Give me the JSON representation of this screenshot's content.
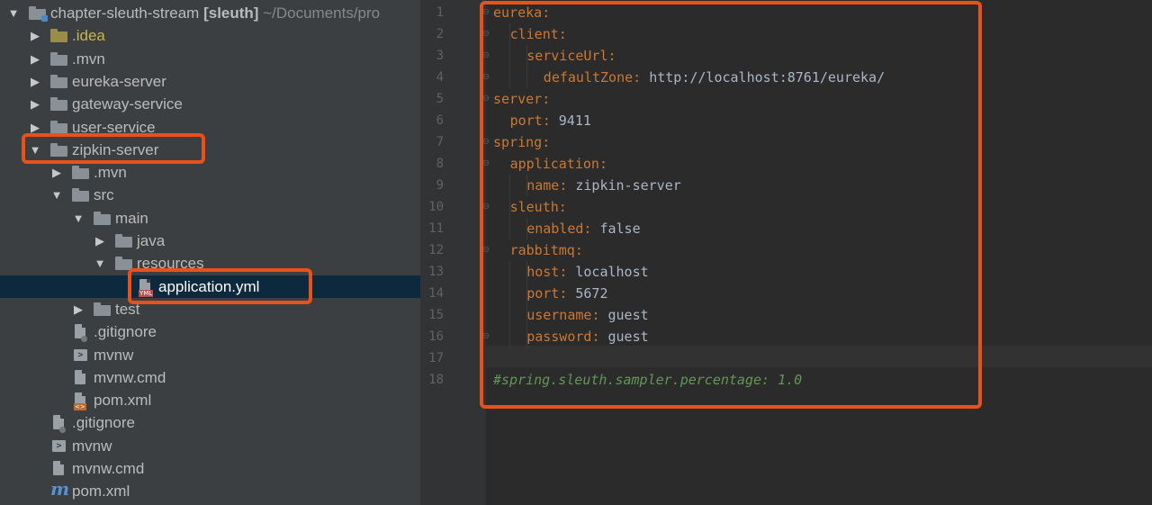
{
  "project": {
    "root_name": "chapter-sleuth-stream",
    "root_module": "[sleuth]",
    "root_path": "~/Documents/pro",
    "tree": [
      {
        "label": ".idea",
        "type": "folder",
        "variant": "idea"
      },
      {
        "label": ".mvn",
        "type": "folder"
      },
      {
        "label": "eureka-server",
        "type": "folder",
        "variant": "module"
      },
      {
        "label": "gateway-service",
        "type": "folder",
        "variant": "module"
      },
      {
        "label": "user-service",
        "type": "folder",
        "variant": "module"
      },
      {
        "label": "zipkin-server",
        "type": "folder",
        "variant": "module",
        "expanded": true
      },
      {
        "label": ".mvn",
        "type": "folder"
      },
      {
        "label": "src",
        "type": "folder",
        "expanded": true
      },
      {
        "label": "main",
        "type": "folder",
        "expanded": true
      },
      {
        "label": "java",
        "type": "folder"
      },
      {
        "label": "resources",
        "type": "folder",
        "expanded": true
      },
      {
        "label": "application.yml",
        "type": "file",
        "icon": "yml-file-icon",
        "selected": true
      },
      {
        "label": "test",
        "type": "folder"
      },
      {
        "label": ".gitignore",
        "type": "file",
        "icon": "gitignore-file-icon"
      },
      {
        "label": "mvnw",
        "type": "file",
        "icon": "terminal-file-icon"
      },
      {
        "label": "mvnw.cmd",
        "type": "file",
        "icon": "text-file-icon"
      },
      {
        "label": "pom.xml",
        "type": "file",
        "icon": "xml-file-icon"
      },
      {
        "label": ".gitignore",
        "type": "file",
        "icon": "gitignore-file-icon"
      },
      {
        "label": "mvnw",
        "type": "file",
        "icon": "terminal-file-icon"
      },
      {
        "label": "mvnw.cmd",
        "type": "file",
        "icon": "text-file-icon"
      },
      {
        "label": "pom.xml",
        "type": "file",
        "icon": "maven-icon"
      }
    ]
  },
  "editor": {
    "file": "application.yml",
    "current_line": 17,
    "line_numbers": [
      "1",
      "2",
      "3",
      "4",
      "5",
      "6",
      "7",
      "8",
      "9",
      "10",
      "11",
      "12",
      "13",
      "14",
      "15",
      "16",
      "17",
      "18"
    ],
    "lines": [
      {
        "key": "eureka",
        "value": ""
      },
      {
        "key": "client",
        "value": ""
      },
      {
        "key": "serviceUrl",
        "value": ""
      },
      {
        "key": "defaultZone",
        "value": "http://localhost:8761/eureka/"
      },
      {
        "key": "server",
        "value": ""
      },
      {
        "key": "port",
        "value": "9411"
      },
      {
        "key": "spring",
        "value": ""
      },
      {
        "key": "application",
        "value": ""
      },
      {
        "key": "name",
        "value": "zipkin-server"
      },
      {
        "key": "sleuth",
        "value": ""
      },
      {
        "key": "enabled",
        "value": "false"
      },
      {
        "key": "rabbitmq",
        "value": ""
      },
      {
        "key": "host",
        "value": "localhost"
      },
      {
        "key": "port",
        "value": "5672"
      },
      {
        "key": "username",
        "value": "guest"
      },
      {
        "key": "password",
        "value": "guest"
      },
      {
        "key": "",
        "value": ""
      },
      {
        "comment": "#spring.sleuth.sampler.percentage: 1.0"
      }
    ]
  },
  "colors": {
    "tree_bg": "#3c3f41",
    "editor_bg": "#2b2b2b",
    "key": "#cc7832",
    "value": "#a9b7c6",
    "comment": "#629755",
    "highlight_box": "#e8521a",
    "selection": "#0d293e"
  }
}
